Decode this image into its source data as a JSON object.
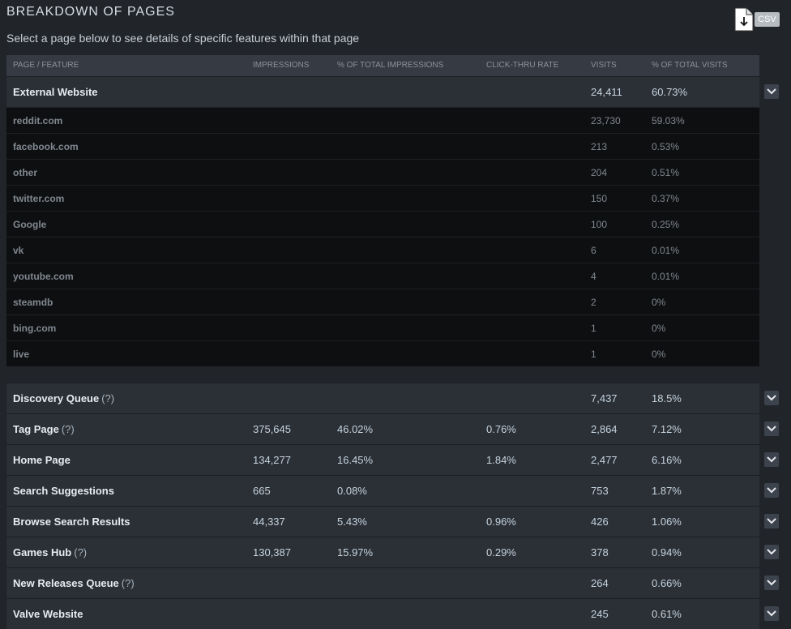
{
  "header": {
    "title": "BREAKDOWN OF PAGES",
    "subtitle": "Select a page below to see details of specific features within that page",
    "csv_label": "CSV"
  },
  "columns": [
    "PAGE / FEATURE",
    "IMPRESSIONS",
    "% OF TOTAL IMPRESSIONS",
    "CLICK-THRU RATE",
    "VISITS",
    "% OF TOTAL VISITS"
  ],
  "expanded": {
    "name": "External Website",
    "visits": "24,411",
    "pct_visits": "60.73%",
    "sub": [
      {
        "name": "reddit.com",
        "visits": "23,730",
        "pct": "59.03%"
      },
      {
        "name": "facebook.com",
        "visits": "213",
        "pct": "0.53%"
      },
      {
        "name": "other",
        "visits": "204",
        "pct": "0.51%"
      },
      {
        "name": "twitter.com",
        "visits": "150",
        "pct": "0.37%"
      },
      {
        "name": "Google",
        "visits": "100",
        "pct": "0.25%"
      },
      {
        "name": "vk",
        "visits": "6",
        "pct": "0.01%"
      },
      {
        "name": "youtube.com",
        "visits": "4",
        "pct": "0.01%"
      },
      {
        "name": "steamdb",
        "visits": "2",
        "pct": "0%"
      },
      {
        "name": "bing.com",
        "visits": "1",
        "pct": "0%"
      },
      {
        "name": "live",
        "visits": "1",
        "pct": "0%"
      }
    ]
  },
  "rows": [
    {
      "name": "Discovery Queue",
      "help": "(?)",
      "impressions": "",
      "pct_impr": "",
      "ctr": "",
      "visits": "7,437",
      "pct_visits": "18.5%"
    },
    {
      "name": "Tag Page",
      "help": "(?)",
      "impressions": "375,645",
      "pct_impr": "46.02%",
      "ctr": "0.76%",
      "visits": "2,864",
      "pct_visits": "7.12%"
    },
    {
      "name": "Home Page",
      "help": "",
      "impressions": "134,277",
      "pct_impr": "16.45%",
      "ctr": "1.84%",
      "visits": "2,477",
      "pct_visits": "6.16%"
    },
    {
      "name": "Search Suggestions",
      "help": "",
      "impressions": "665",
      "pct_impr": "0.08%",
      "ctr": "",
      "visits": "753",
      "pct_visits": "1.87%"
    },
    {
      "name": "Browse Search Results",
      "help": "",
      "impressions": "44,337",
      "pct_impr": "5.43%",
      "ctr": "0.96%",
      "visits": "426",
      "pct_visits": "1.06%"
    },
    {
      "name": "Games Hub",
      "help": "(?)",
      "impressions": "130,387",
      "pct_impr": "15.97%",
      "ctr": "0.29%",
      "visits": "378",
      "pct_visits": "0.94%"
    },
    {
      "name": "New Releases Queue",
      "help": "(?)",
      "impressions": "",
      "pct_impr": "",
      "ctr": "",
      "visits": "264",
      "pct_visits": "0.66%"
    },
    {
      "name": "Valve Website",
      "help": "",
      "impressions": "",
      "pct_impr": "",
      "ctr": "",
      "visits": "245",
      "pct_visits": "0.61%"
    }
  ]
}
